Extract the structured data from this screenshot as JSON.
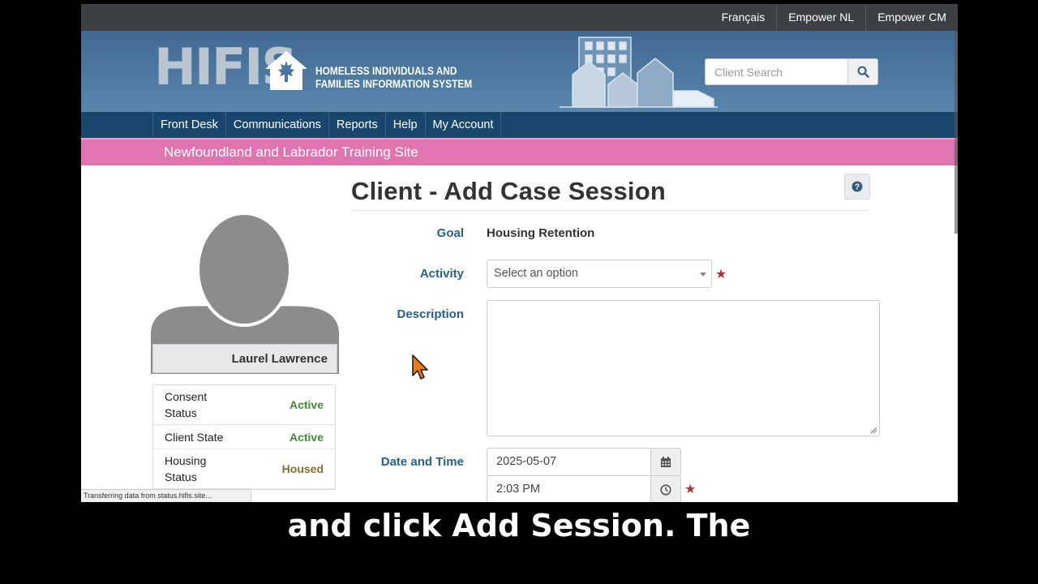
{
  "top_links": [
    "Français",
    "Empower NL",
    "Empower CM"
  ],
  "brand": {
    "acronym": "HIFIS",
    "subtitle_line1": "HOMELESS INDIVIDUALS AND",
    "subtitle_line2": "FAMILIES INFORMATION SYSTEM"
  },
  "search": {
    "placeholder": "Client Search",
    "icon": "search-icon"
  },
  "nav": [
    "Front Desk",
    "Communications",
    "Reports",
    "Help",
    "My Account"
  ],
  "site_banner": "Newfoundland and Labrador Training Site",
  "page": {
    "title": "Client - Add Case Session"
  },
  "client": {
    "name": "Laurel Lawrence",
    "statuses": [
      {
        "label": "Consent Status",
        "value": "Active",
        "color": "#3f8a36"
      },
      {
        "label": "Client State",
        "value": "Active",
        "color": "#3f8a36"
      },
      {
        "label": "Housing Status",
        "value": "Housed",
        "color": "#8a6d2a"
      }
    ]
  },
  "form": {
    "goal_label": "Goal",
    "goal_value": "Housing Retention",
    "activity_label": "Activity",
    "activity_placeholder": "Select an option",
    "description_label": "Description",
    "datetime_label": "Date and Time",
    "date_value": "2025-05-07",
    "time_value": "2:03 PM",
    "required_mark": "★"
  },
  "browser_status": "Transferring data from status.hifis.site...",
  "caption": "and click Add Session. The",
  "colors": {
    "nav_bg": "#19466c",
    "banner_bg": "#4f7aa2",
    "site_banner_bg": "#df74b0",
    "label_blue": "#256190",
    "required_red": "#a03a3a"
  }
}
